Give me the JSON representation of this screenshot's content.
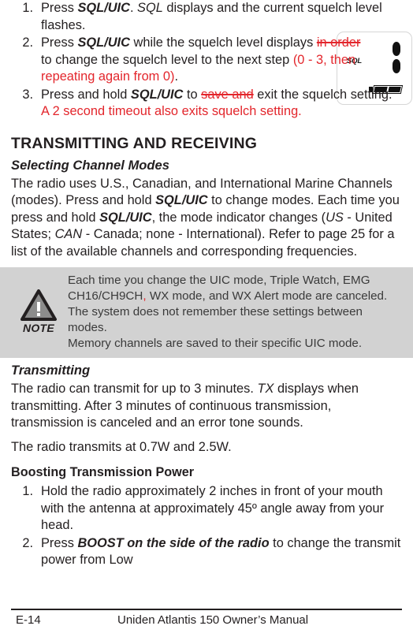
{
  "top_list": {
    "items": [
      {
        "num": "1.",
        "parts": [
          {
            "t": "Press ",
            "s": "n"
          },
          {
            "t": "SQL/UIC",
            "s": "b"
          },
          {
            "t": ". ",
            "s": "n"
          },
          {
            "t": "SQL",
            "s": "i"
          },
          {
            "t": " displays and the current squelch level flashes.",
            "s": "n"
          }
        ]
      },
      {
        "num": "2.",
        "parts": [
          {
            "t": "Press ",
            "s": "n"
          },
          {
            "t": "SQL/UIC",
            "s": "b"
          },
          {
            "t": " while the squelch level displays ",
            "s": "n"
          },
          {
            "t": "in order ",
            "s": "del"
          },
          {
            "t": "to change the squelch level to the next step ",
            "s": "n"
          },
          {
            "t": "(0 - 3, then repeating again from 0)",
            "s": "red"
          },
          {
            "t": ".",
            "s": "n"
          }
        ]
      },
      {
        "num": "3.",
        "parts": [
          {
            "t": "Press and hold ",
            "s": "n"
          },
          {
            "t": "SQL/UIC",
            "s": "b"
          },
          {
            "t": " to ",
            "s": "n"
          },
          {
            "t": "save and",
            "s": "del"
          },
          {
            "t": " exit the squelch setting. ",
            "s": "n"
          },
          {
            "t": "A 2 second timeout also exits squelch setting.",
            "s": "red"
          }
        ]
      }
    ]
  },
  "lcd": {
    "label": "SQL",
    "bars": 2,
    "battery_segments": 2
  },
  "section": {
    "heading": "TRANSMITTING AND RECEIVING",
    "sub_heading": "Selecting Channel Modes",
    "body_parts": [
      {
        "t": "The radio uses U.S., Canadian, and International Marine Channels (modes). Press and hold ",
        "s": "n"
      },
      {
        "t": "SQL/UIC",
        "s": "b"
      },
      {
        "t": " to change modes. Each time you press and hold ",
        "s": "n"
      },
      {
        "t": "SQL/UIC",
        "s": "b"
      },
      {
        "t": ", the mode indicator changes (",
        "s": "n"
      },
      {
        "t": "US",
        "s": "i"
      },
      {
        "t": " - United States; ",
        "s": "n"
      },
      {
        "t": "CAN",
        "s": "i"
      },
      {
        "t": " - Canada; none - International). Refer to page 25 for a list of the available channels and corresponding frequencies.",
        "s": "n"
      }
    ]
  },
  "note": {
    "label": "NOTE",
    "icon": "warning-triangle-icon",
    "paragraph_1_parts": [
      {
        "t": "Each time you change the UIC mode, Triple Watch, EMG CH16/CH9CH",
        "s": "n"
      },
      {
        "t": ",",
        "s": "red"
      },
      {
        "t": " WX mode, and WX Alert mode are canceled. The system does not remember these settings between modes.",
        "s": "n"
      }
    ],
    "paragraph_2": "Memory channels are saved to their specific UIC mode."
  },
  "transmitting": {
    "heading": "Transmitting",
    "para1_parts": [
      {
        "t": "The radio can transmit for up to 3 minutes. ",
        "s": "n"
      },
      {
        "t": "TX",
        "s": "i"
      },
      {
        "t": " displays when transmitting. After 3 minutes of continuous transmission, transmission is canceled and an error tone sounds.",
        "s": "n"
      }
    ],
    "para2": "The radio transmits at 0.7W and 2.5W."
  },
  "boosting": {
    "heading": "Boosting Transmission Power",
    "items": [
      {
        "num": "1.",
        "parts": [
          {
            "t": "Hold the radio approximately 2 inches in front of your mouth with the antenna at approximately 45º angle away from your head.",
            "s": "n"
          }
        ]
      },
      {
        "num": "2.",
        "parts": [
          {
            "t": "Press ",
            "s": "n"
          },
          {
            "t": "BOOST on the side of the radio",
            "s": "b"
          },
          {
            "t": " to change the transmit power from Low",
            "s": "n"
          }
        ]
      }
    ]
  },
  "footer": {
    "page": "E-14",
    "title": "Uniden Atlantis 150 Owner’s Manual"
  },
  "colors": {
    "text": "#231f20",
    "edit_red": "#e3262c",
    "note_bg": "#d2d2d2"
  }
}
